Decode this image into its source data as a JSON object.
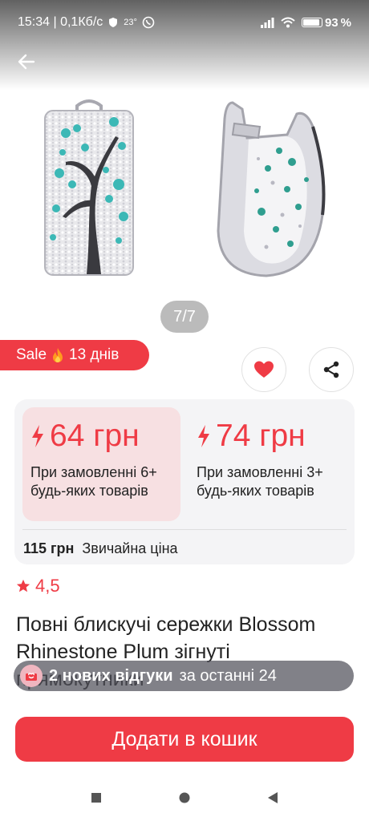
{
  "status_bar": {
    "time": "15:34 | 0,1Кб/с",
    "temperature": "23°",
    "battery": "93",
    "battery_unit": "%",
    "battery_level": 0.93
  },
  "gallery": {
    "counter": "7/7"
  },
  "sale_badge": {
    "label": "Sale",
    "days": "13 днів"
  },
  "pricing": {
    "tiers": [
      {
        "price": "64 грн",
        "description": "При замовленні 6+ будь-яких товарів"
      },
      {
        "price": "74 грн",
        "description": "При замовленні 3+ будь-яких товарів"
      }
    ],
    "regular_price": "115 грн",
    "regular_label": "Звичайна ціна"
  },
  "rating": {
    "value": "4,5"
  },
  "product": {
    "title": "Повні блискучі сережки Blossom Rhinestone Plum зігнуті прямокутники"
  },
  "reviews_toast": {
    "strong": "2 нових відгуки",
    "rest": "за останні 24"
  },
  "cart_button": {
    "label": "Додати в кошик"
  },
  "icons": [
    "back-arrow-icon",
    "heart-icon",
    "share-icon",
    "fire-icon",
    "bolt-icon",
    "star-icon",
    "gift-icon",
    "wifi-icon",
    "signal-icon"
  ],
  "colors": {
    "accent": "#ef3b45",
    "tier_highlight": "#f7e0e2",
    "card_bg": "#f4f4f6"
  }
}
